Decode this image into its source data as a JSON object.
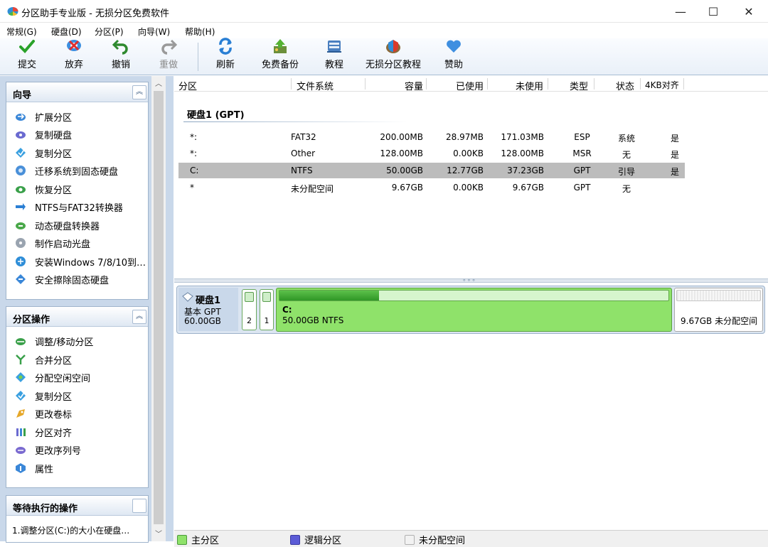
{
  "window": {
    "title": "分区助手专业版 - 无损分区免费软件",
    "minimize": "—",
    "maximize": "☐",
    "close": "✕"
  },
  "menu": [
    "常规(G)",
    "硬盘(D)",
    "分区(P)",
    "向导(W)",
    "帮助(H)"
  ],
  "toolbar": {
    "submit": "提交",
    "discard": "放弃",
    "undo": "撤销",
    "redo": "重做",
    "refresh": "刷新",
    "backup": "免费备份",
    "tutorial": "教程",
    "lossless_tutorial": "无损分区教程",
    "donate": "赞助"
  },
  "wizard_panel": {
    "title": "向导",
    "items": [
      "扩展分区",
      "复制硬盘",
      "复制分区",
      "迁移系统到固态硬盘",
      "恢复分区",
      "NTFS与FAT32转换器",
      "动态硬盘转换器",
      "制作启动光盘",
      "安装Windows 7/8/10到…",
      "安全擦除固态硬盘"
    ]
  },
  "partition_panel": {
    "title": "分区操作",
    "items": [
      "调整/移动分区",
      "合并分区",
      "分配空闲空间",
      "复制分区",
      "更改卷标",
      "分区对齐",
      "更改序列号",
      "属性"
    ]
  },
  "pending_panel": {
    "title": "等待执行的操作",
    "items": [
      "1.调整分区(C:)的大小在硬盘…"
    ]
  },
  "table": {
    "headers": [
      "分区",
      "文件系统",
      "容量",
      "已使用",
      "未使用",
      "类型",
      "状态",
      "4KB对齐"
    ],
    "disk_group": "硬盘1 (GPT)",
    "rows": [
      {
        "partition": "*:",
        "fs": "FAT32",
        "capacity": "200.00MB",
        "used": "28.97MB",
        "unused": "171.03MB",
        "type": "ESP",
        "status": "系统",
        "aligned": "是"
      },
      {
        "partition": "*:",
        "fs": "Other",
        "capacity": "128.00MB",
        "used": "0.00KB",
        "unused": "128.00MB",
        "type": "MSR",
        "status": "无",
        "aligned": "是"
      },
      {
        "partition": "C:",
        "fs": "NTFS",
        "capacity": "50.00GB",
        "used": "12.77GB",
        "unused": "37.23GB",
        "type": "GPT",
        "status": "引导",
        "aligned": "是"
      },
      {
        "partition": "*",
        "fs": "未分配空间",
        "capacity": "9.67GB",
        "used": "0.00KB",
        "unused": "9.67GB",
        "type": "GPT",
        "status": "无",
        "aligned": ""
      }
    ]
  },
  "diskmap": {
    "disk_name": "硬盘1",
    "disk_type": "基本 GPT",
    "disk_size": "60.00GB",
    "small_part_1": "2",
    "small_part_2": "1",
    "c_label": "C:",
    "c_desc": "50.00GB NTFS",
    "c_used_fraction": 0.2554,
    "unalloc_desc": "9.67GB 未分配空间"
  },
  "legend": {
    "primary": "主分区",
    "logical": "逻辑分区",
    "unallocated": "未分配空间"
  },
  "colors": {
    "primary": "#8fe26a",
    "logical": "#5b5bd6",
    "unallocated": "#f2f2f2",
    "accent": "#3a7bd5"
  }
}
